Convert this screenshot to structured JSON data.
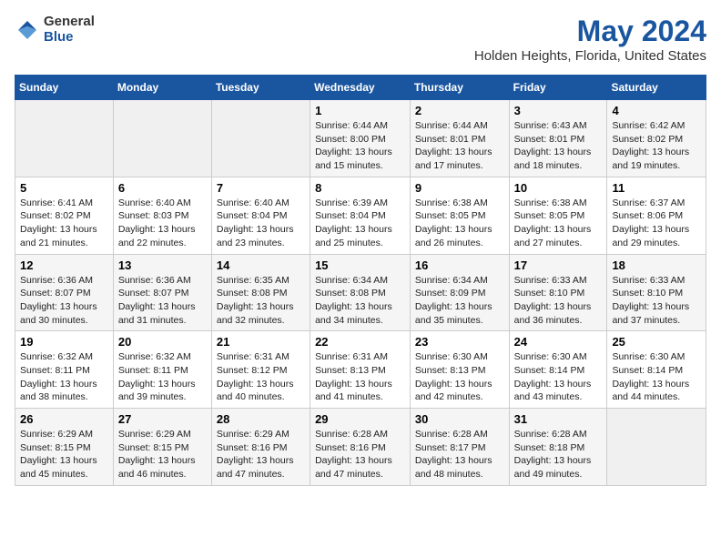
{
  "header": {
    "logo_general": "General",
    "logo_blue": "Blue",
    "main_title": "May 2024",
    "subtitle": "Holden Heights, Florida, United States"
  },
  "days_of_week": [
    "Sunday",
    "Monday",
    "Tuesday",
    "Wednesday",
    "Thursday",
    "Friday",
    "Saturday"
  ],
  "weeks": [
    [
      {
        "day": "",
        "info": ""
      },
      {
        "day": "",
        "info": ""
      },
      {
        "day": "",
        "info": ""
      },
      {
        "day": "1",
        "info": "Sunrise: 6:44 AM\nSunset: 8:00 PM\nDaylight: 13 hours and 15 minutes."
      },
      {
        "day": "2",
        "info": "Sunrise: 6:44 AM\nSunset: 8:01 PM\nDaylight: 13 hours and 17 minutes."
      },
      {
        "day": "3",
        "info": "Sunrise: 6:43 AM\nSunset: 8:01 PM\nDaylight: 13 hours and 18 minutes."
      },
      {
        "day": "4",
        "info": "Sunrise: 6:42 AM\nSunset: 8:02 PM\nDaylight: 13 hours and 19 minutes."
      }
    ],
    [
      {
        "day": "5",
        "info": "Sunrise: 6:41 AM\nSunset: 8:02 PM\nDaylight: 13 hours and 21 minutes."
      },
      {
        "day": "6",
        "info": "Sunrise: 6:40 AM\nSunset: 8:03 PM\nDaylight: 13 hours and 22 minutes."
      },
      {
        "day": "7",
        "info": "Sunrise: 6:40 AM\nSunset: 8:04 PM\nDaylight: 13 hours and 23 minutes."
      },
      {
        "day": "8",
        "info": "Sunrise: 6:39 AM\nSunset: 8:04 PM\nDaylight: 13 hours and 25 minutes."
      },
      {
        "day": "9",
        "info": "Sunrise: 6:38 AM\nSunset: 8:05 PM\nDaylight: 13 hours and 26 minutes."
      },
      {
        "day": "10",
        "info": "Sunrise: 6:38 AM\nSunset: 8:05 PM\nDaylight: 13 hours and 27 minutes."
      },
      {
        "day": "11",
        "info": "Sunrise: 6:37 AM\nSunset: 8:06 PM\nDaylight: 13 hours and 29 minutes."
      }
    ],
    [
      {
        "day": "12",
        "info": "Sunrise: 6:36 AM\nSunset: 8:07 PM\nDaylight: 13 hours and 30 minutes."
      },
      {
        "day": "13",
        "info": "Sunrise: 6:36 AM\nSunset: 8:07 PM\nDaylight: 13 hours and 31 minutes."
      },
      {
        "day": "14",
        "info": "Sunrise: 6:35 AM\nSunset: 8:08 PM\nDaylight: 13 hours and 32 minutes."
      },
      {
        "day": "15",
        "info": "Sunrise: 6:34 AM\nSunset: 8:08 PM\nDaylight: 13 hours and 34 minutes."
      },
      {
        "day": "16",
        "info": "Sunrise: 6:34 AM\nSunset: 8:09 PM\nDaylight: 13 hours and 35 minutes."
      },
      {
        "day": "17",
        "info": "Sunrise: 6:33 AM\nSunset: 8:10 PM\nDaylight: 13 hours and 36 minutes."
      },
      {
        "day": "18",
        "info": "Sunrise: 6:33 AM\nSunset: 8:10 PM\nDaylight: 13 hours and 37 minutes."
      }
    ],
    [
      {
        "day": "19",
        "info": "Sunrise: 6:32 AM\nSunset: 8:11 PM\nDaylight: 13 hours and 38 minutes."
      },
      {
        "day": "20",
        "info": "Sunrise: 6:32 AM\nSunset: 8:11 PM\nDaylight: 13 hours and 39 minutes."
      },
      {
        "day": "21",
        "info": "Sunrise: 6:31 AM\nSunset: 8:12 PM\nDaylight: 13 hours and 40 minutes."
      },
      {
        "day": "22",
        "info": "Sunrise: 6:31 AM\nSunset: 8:13 PM\nDaylight: 13 hours and 41 minutes."
      },
      {
        "day": "23",
        "info": "Sunrise: 6:30 AM\nSunset: 8:13 PM\nDaylight: 13 hours and 42 minutes."
      },
      {
        "day": "24",
        "info": "Sunrise: 6:30 AM\nSunset: 8:14 PM\nDaylight: 13 hours and 43 minutes."
      },
      {
        "day": "25",
        "info": "Sunrise: 6:30 AM\nSunset: 8:14 PM\nDaylight: 13 hours and 44 minutes."
      }
    ],
    [
      {
        "day": "26",
        "info": "Sunrise: 6:29 AM\nSunset: 8:15 PM\nDaylight: 13 hours and 45 minutes."
      },
      {
        "day": "27",
        "info": "Sunrise: 6:29 AM\nSunset: 8:15 PM\nDaylight: 13 hours and 46 minutes."
      },
      {
        "day": "28",
        "info": "Sunrise: 6:29 AM\nSunset: 8:16 PM\nDaylight: 13 hours and 47 minutes."
      },
      {
        "day": "29",
        "info": "Sunrise: 6:28 AM\nSunset: 8:16 PM\nDaylight: 13 hours and 47 minutes."
      },
      {
        "day": "30",
        "info": "Sunrise: 6:28 AM\nSunset: 8:17 PM\nDaylight: 13 hours and 48 minutes."
      },
      {
        "day": "31",
        "info": "Sunrise: 6:28 AM\nSunset: 8:18 PM\nDaylight: 13 hours and 49 minutes."
      },
      {
        "day": "",
        "info": ""
      }
    ]
  ]
}
